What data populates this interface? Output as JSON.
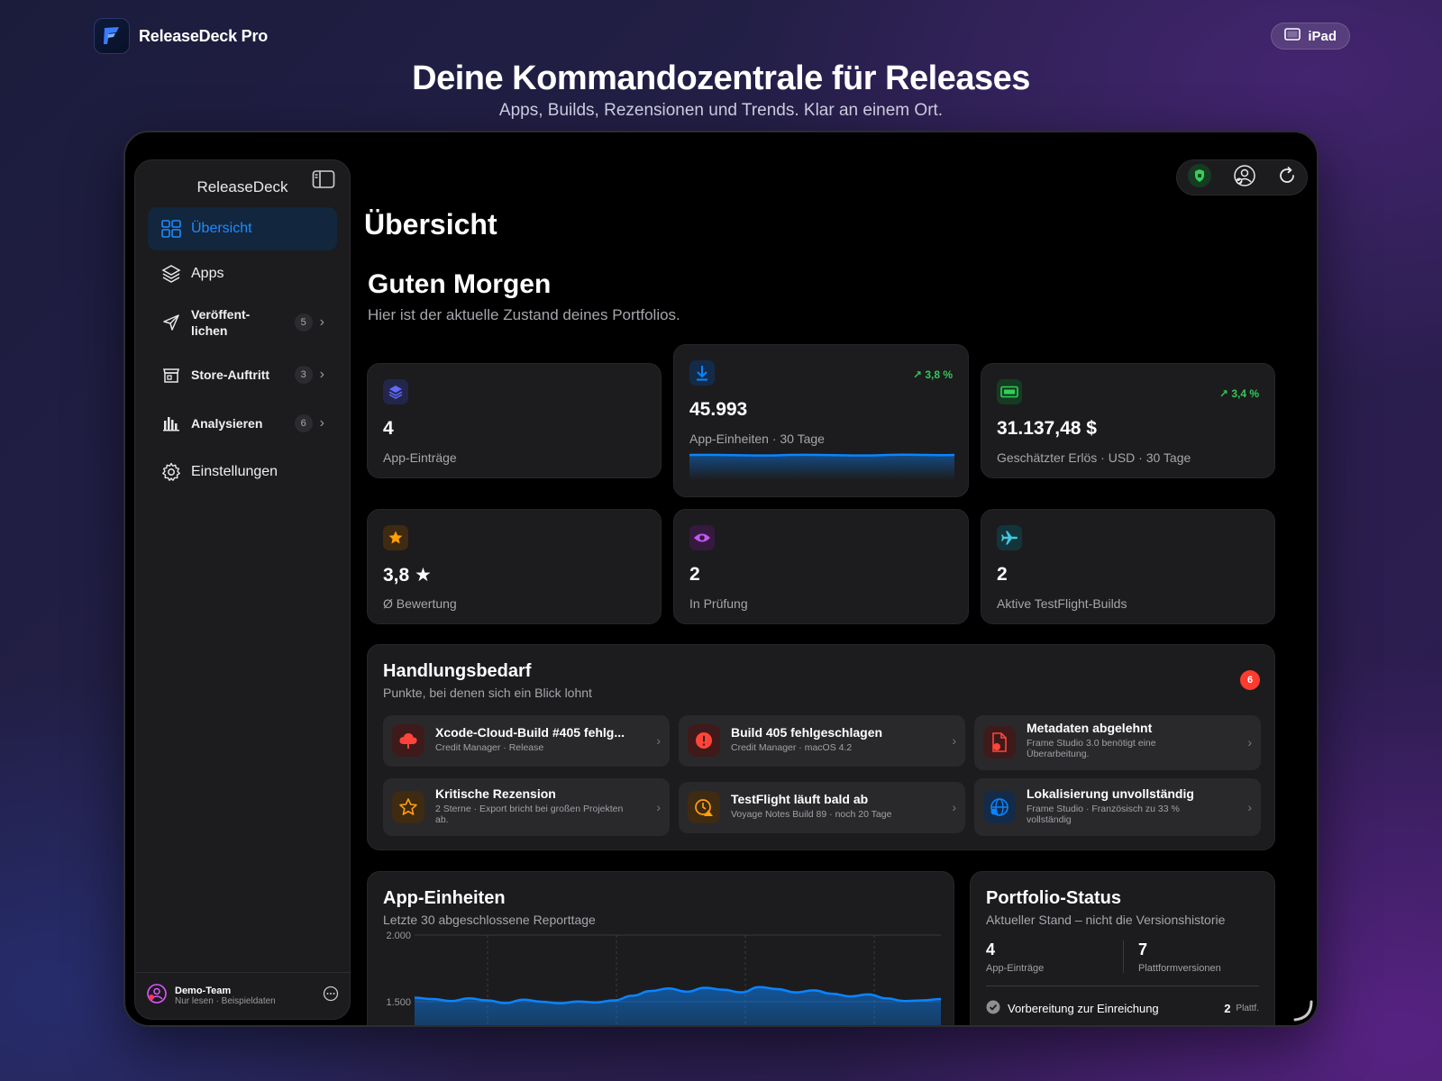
{
  "app": {
    "name": "ReleaseDeck Pro",
    "device": "iPad"
  },
  "hero": {
    "title": "Deine Kommandozentrale für Releases",
    "subtitle": "Apps, Builds, Rezensionen und Trends. Klar an einem Ort."
  },
  "sidebar": {
    "title": "ReleaseDeck",
    "items": [
      {
        "label": "Übersicht",
        "icon": "grid-icon",
        "active": true
      },
      {
        "label": "Apps",
        "icon": "stack-icon"
      },
      {
        "label": "Veröffent-lichen",
        "icon": "paper-plane-icon",
        "count": "5"
      },
      {
        "label": "Store-Auftritt",
        "icon": "storefront-icon",
        "count": "3"
      },
      {
        "label": "Analysieren",
        "icon": "bar-chart-icon",
        "count": "6"
      },
      {
        "label": "Einstellungen",
        "icon": "gear-icon"
      }
    ],
    "footer": {
      "team": "Demo-Team",
      "mode": "Nur lesen · Beispieldaten"
    }
  },
  "page": {
    "title": "Übersicht",
    "greeting": "Guten Morgen",
    "greeting_sub": "Hier ist der aktuelle Zustand deines Portfolios."
  },
  "kpis": [
    {
      "value": "4",
      "label": "App-Einträge",
      "icon": "stack-icon",
      "color": "#5e6bff"
    },
    {
      "value": "45.993",
      "label": "App-Einheiten · 30 Tage",
      "icon": "download-icon",
      "color": "#0a84ff",
      "trend": "3,8 %"
    },
    {
      "value": "31.137,48 $",
      "label": "Geschätzter Erlös · USD · 30 Tage",
      "icon": "banknote-icon",
      "color": "#30d158",
      "trend": "3,4 %"
    },
    {
      "value": "3,8 ★",
      "label": "Ø Bewertung",
      "icon": "star-icon",
      "color": "#ff9f0a"
    },
    {
      "value": "2",
      "label": "In Prüfung",
      "icon": "eye-icon",
      "color": "#bf5af2"
    },
    {
      "value": "2",
      "label": "Aktive TestFlight-Builds",
      "icon": "airplane-icon",
      "color": "#40c8e0"
    }
  ],
  "actions": {
    "title": "Handlungsbedarf",
    "subtitle": "Punkte, bei denen sich ein Blick lohnt",
    "count": "6",
    "items": [
      {
        "title": "Xcode-Cloud-Build #405 fehlg...",
        "sub": "Credit Manager · Release",
        "icon": "cloud-error-icon",
        "color": "#ff453a"
      },
      {
        "title": "Build 405 fehlgeschlagen",
        "sub": "Credit Manager · macOS 4.2",
        "icon": "exclamation-icon",
        "color": "#ff453a"
      },
      {
        "title": "Metadaten abgelehnt",
        "sub": "Frame Studio 3.0 benötigt eine Überarbeitung.",
        "icon": "document-error-icon",
        "color": "#ff453a"
      },
      {
        "title": "Kritische Rezension",
        "sub": "2 Sterne · Export bricht bei großen Projekten ab.",
        "icon": "star-outline-icon",
        "color": "#ff9f0a"
      },
      {
        "title": "TestFlight läuft bald ab",
        "sub": "Voyage Notes Build 89 · noch 20 Tage",
        "icon": "clock-warning-icon",
        "color": "#ff9f0a"
      },
      {
        "title": "Lokalisierung unvollständig",
        "sub": "Frame Studio · Französisch zu 33 % vollständig",
        "icon": "globe-icon",
        "color": "#0a84ff"
      }
    ]
  },
  "units_chart": {
    "title": "App-Einheiten",
    "subtitle": "Letzte 30 abgeschlossene Reporttage",
    "y_ticks": [
      "2.000",
      "1.500"
    ]
  },
  "portfolio": {
    "title": "Portfolio-Status",
    "subtitle": "Aktueller Stand – nicht die Versionshistorie",
    "stats": [
      {
        "value": "4",
        "label": "App-Einträge"
      },
      {
        "value": "7",
        "label": "Plattformversionen"
      }
    ],
    "row": {
      "label": "Vorbereitung zur Einreichung",
      "value": "2",
      "unit": "Plattf."
    }
  },
  "chart_data": {
    "type": "area",
    "title": "App-Einheiten",
    "subtitle": "Letzte 30 abgeschlossene Reporttage",
    "y_tick_labels": [
      "2.000",
      "1.500"
    ],
    "ylim": [
      1400,
      2000
    ],
    "values": [
      1530,
      1520,
      1505,
      1525,
      1510,
      1490,
      1515,
      1500,
      1488,
      1502,
      1495,
      1510,
      1545,
      1580,
      1600,
      1575,
      1605,
      1590,
      1570,
      1610,
      1595,
      1570,
      1585,
      1560,
      1540,
      1555,
      1525,
      1505,
      1510,
      1520
    ],
    "grid": true
  }
}
